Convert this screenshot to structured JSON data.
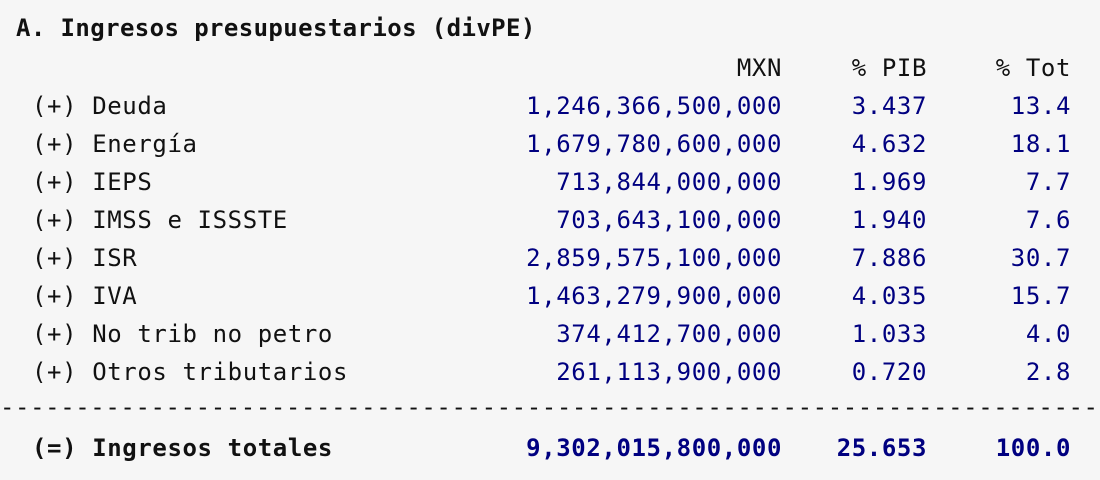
{
  "table": {
    "title": "A. Ingresos presupuestarios (divPE)",
    "headers": {
      "mxn": "MXN",
      "pib": "% PIB",
      "tot": "% Tot"
    },
    "rows": [
      {
        "label": "(+) Deuda",
        "mxn": "1,246,366,500,000",
        "pib": "3.437",
        "tot": "13.4"
      },
      {
        "label": "(+) Energía",
        "mxn": "1,679,780,600,000",
        "pib": "4.632",
        "tot": "18.1"
      },
      {
        "label": "(+) IEPS",
        "mxn": "713,844,000,000",
        "pib": "1.969",
        "tot": "7.7"
      },
      {
        "label": "(+) IMSS e ISSSTE",
        "mxn": "703,643,100,000",
        "pib": "1.940",
        "tot": "7.6"
      },
      {
        "label": "(+) ISR",
        "mxn": "2,859,575,100,000",
        "pib": "7.886",
        "tot": "30.7"
      },
      {
        "label": "(+) IVA",
        "mxn": "1,463,279,900,000",
        "pib": "4.035",
        "tot": "15.7"
      },
      {
        "label": "(+) No trib no petro",
        "mxn": "374,412,700,000",
        "pib": "1.033",
        "tot": "4.0"
      },
      {
        "label": "(+) Otros tributarios",
        "mxn": "261,113,900,000",
        "pib": "0.720",
        "tot": "2.8"
      }
    ],
    "divider": "-------------------------------------------------------------------------------------",
    "total": {
      "label": "(=) Ingresos totales",
      "mxn": "9,302,015,800,000",
      "pib": "25.653",
      "tot": "100.0"
    }
  }
}
